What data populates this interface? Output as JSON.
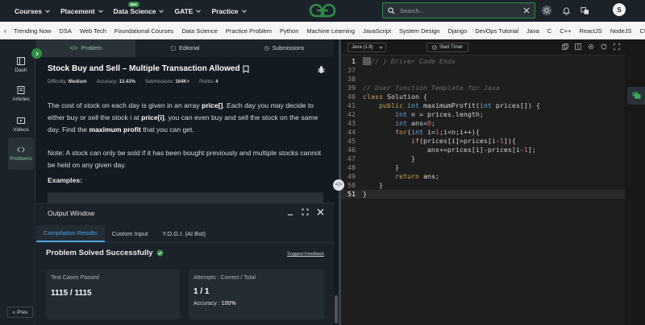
{
  "topnav": {
    "menu": [
      {
        "label": "Courses"
      },
      {
        "label": "Placement"
      },
      {
        "label": "Data Science",
        "badge": "IBM"
      },
      {
        "label": "GATE"
      },
      {
        "label": "Practice"
      }
    ],
    "logo_icon": "gfg-logo-icon",
    "search_placeholder": "Search...",
    "avatar_initial": "S",
    "brand_color": "#2f8d46"
  },
  "subnav": {
    "items": [
      "Trending Now",
      "DSA",
      "Web Tech",
      "Foundational Courses",
      "Data Science",
      "Practice Problem",
      "Python",
      "Machine Learning",
      "JavaScript",
      "System Design",
      "Django",
      "DevOps Tutorial",
      "Java",
      "C",
      "C++",
      "ReactJS",
      "NodeJS",
      "CP Live"
    ]
  },
  "sidebar": {
    "items": [
      {
        "label": "Dash",
        "icon": "dashboard-icon"
      },
      {
        "label": "Articles",
        "icon": "articles-icon"
      },
      {
        "label": "Videos",
        "icon": "videos-icon"
      },
      {
        "label": "Problems",
        "icon": "code-icon"
      }
    ],
    "prev_label": "Prev"
  },
  "problem": {
    "tabs": [
      "Problem",
      "Editorial",
      "Submissions"
    ],
    "title": "Stock Buy and Sell – Multiple Transaction Allowed",
    "difficulty_label": "Difficulty:",
    "difficulty": "Medium",
    "accuracy_label": "Accuracy:",
    "accuracy": "13.43%",
    "submissions_label": "Submissions:",
    "submissions": "164K+",
    "points_label": "Points:",
    "points": "4",
    "para1_a": "The cost of stock on each day is given in an array ",
    "para1_b": "price[]",
    "para1_c": ". Each day you may decide to either buy or sell the stock i at ",
    "para1_d": "price[i]",
    "para1_e": ", you can even buy and sell the stock on the same day. Find the ",
    "para1_f": "maximum profit",
    "para1_g": " that you can get.",
    "note": "Note: A stock can only be sold if it has been bought previously and multiple stocks cannot be held on any given day.",
    "examples_heading": "Examples:"
  },
  "output": {
    "title": "Output Window",
    "tabs": [
      "Compilation Results",
      "Custom Input",
      "Y.O.G.I. (AI Bot)"
    ],
    "status": "Problem Solved Successfully",
    "suggest": "Suggest Feedback",
    "tests_label": "Test Cases Passed",
    "tests_value": "1115 / 1115",
    "attempts_label": "Attempts : Correct / Total",
    "attempts_value": "1 / 1",
    "accuracy_label": "Accuracy :",
    "accuracy_value": "100%"
  },
  "editor": {
    "language": "Java (1.8)",
    "timer_label": "Start Timer",
    "lines": [
      {
        "n": "1",
        "text": "} // } Driver Code Ends",
        "kind": "comment"
      },
      {
        "n": "37",
        "text": ""
      },
      {
        "n": "38",
        "text": ""
      },
      {
        "n": "39",
        "text": "// User function Template for Java",
        "kind": "comment"
      },
      {
        "n": "40",
        "text": "class Solution {"
      },
      {
        "n": "41",
        "text": "    public int maximumProfit(int prices[]) {"
      },
      {
        "n": "42",
        "text": "        int n = prices.length;"
      },
      {
        "n": "43",
        "text": "        int ans=0;"
      },
      {
        "n": "44",
        "text": "        for(int i=1;i<n;i++){"
      },
      {
        "n": "45",
        "text": "            if(prices[i]>prices[i-1]){"
      },
      {
        "n": "46",
        "text": "                ans+=prices[i]-prices[i-1];"
      },
      {
        "n": "47",
        "text": "            }"
      },
      {
        "n": "48",
        "text": "        }"
      },
      {
        "n": "49",
        "text": "        return ans;"
      },
      {
        "n": "50",
        "text": "    }"
      },
      {
        "n": "51",
        "text": "}"
      }
    ]
  }
}
